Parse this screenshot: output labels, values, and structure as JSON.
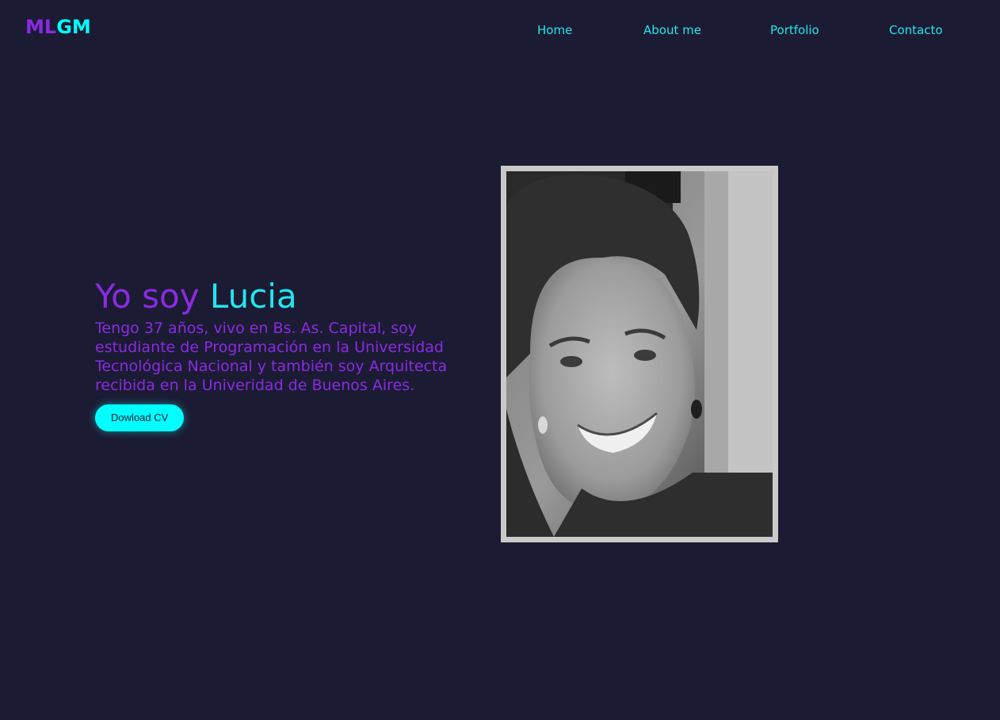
{
  "logo": {
    "part1": "ML",
    "part2": "GM"
  },
  "nav": {
    "items": [
      {
        "label": "Home"
      },
      {
        "label": "About me"
      },
      {
        "label": "Portfolio"
      },
      {
        "label": "Contacto"
      }
    ]
  },
  "hero": {
    "title_prefix": "Yo soy ",
    "title_name": "Lucia",
    "description": "Tengo 37 años, vivo en Bs. As. Capital, soy estudiante de Programación en la Universidad Tecnológica Nacional y también soy Arquitecta recibida en la Univeridad de Buenos Aires.",
    "button_label": "Dowload CV"
  },
  "colors": {
    "background": "#1b1b33",
    "accent_purple": "#8a2be2",
    "accent_cyan": "#00ffff",
    "frame": "#c9c9c9"
  },
  "icons": {
    "profile_photo": "portrait-photo"
  }
}
